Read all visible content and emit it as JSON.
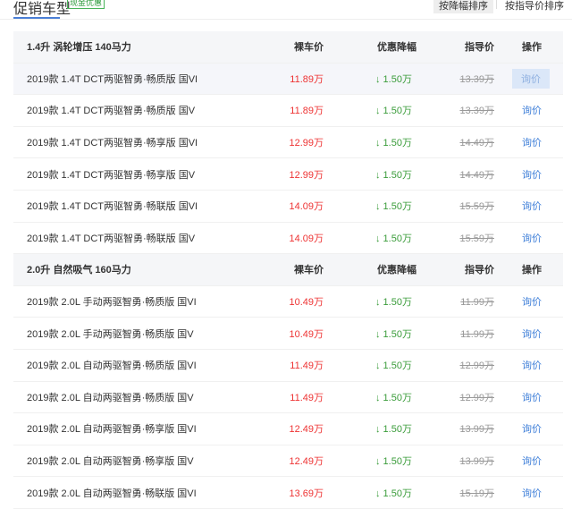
{
  "header": {
    "title": "促销车型",
    "badge": "现金优惠",
    "sort_by_discount": "按降幅排序",
    "sort_by_guide": "按指导价排序"
  },
  "columns": {
    "price": "裸车价",
    "discount": "优惠降幅",
    "guide": "指导价",
    "action": "操作"
  },
  "groups": [
    {
      "name": "1.4升 涡轮增压 140马力",
      "rows": [
        {
          "name": "2019款 1.4T DCT两驱智勇·畅质版 国VI",
          "price": "11.89万",
          "discount": "↓ 1.50万",
          "guide": "13.39万",
          "action": "询价"
        },
        {
          "name": "2019款 1.4T DCT两驱智勇·畅质版 国V",
          "price": "11.89万",
          "discount": "↓ 1.50万",
          "guide": "13.39万",
          "action": "询价"
        },
        {
          "name": "2019款 1.4T DCT两驱智勇·畅享版 国VI",
          "price": "12.99万",
          "discount": "↓ 1.50万",
          "guide": "14.49万",
          "action": "询价"
        },
        {
          "name": "2019款 1.4T DCT两驱智勇·畅享版 国V",
          "price": "12.99万",
          "discount": "↓ 1.50万",
          "guide": "14.49万",
          "action": "询价"
        },
        {
          "name": "2019款 1.4T DCT两驱智勇·畅联版 国VI",
          "price": "14.09万",
          "discount": "↓ 1.50万",
          "guide": "15.59万",
          "action": "询价"
        },
        {
          "name": "2019款 1.4T DCT两驱智勇·畅联版 国V",
          "price": "14.09万",
          "discount": "↓ 1.50万",
          "guide": "15.59万",
          "action": "询价"
        }
      ]
    },
    {
      "name": "2.0升 自然吸气 160马力",
      "rows": [
        {
          "name": "2019款 2.0L 手动两驱智勇·畅质版 国VI",
          "price": "10.49万",
          "discount": "↓ 1.50万",
          "guide": "11.99万",
          "action": "询价"
        },
        {
          "name": "2019款 2.0L 手动两驱智勇·畅质版 国V",
          "price": "10.49万",
          "discount": "↓ 1.50万",
          "guide": "11.99万",
          "action": "询价"
        },
        {
          "name": "2019款 2.0L 自动两驱智勇·畅质版 国VI",
          "price": "11.49万",
          "discount": "↓ 1.50万",
          "guide": "12.99万",
          "action": "询价"
        },
        {
          "name": "2019款 2.0L 自动两驱智勇·畅质版 国V",
          "price": "11.49万",
          "discount": "↓ 1.50万",
          "guide": "12.99万",
          "action": "询价"
        },
        {
          "name": "2019款 2.0L 自动两驱智勇·畅享版 国VI",
          "price": "12.49万",
          "discount": "↓ 1.50万",
          "guide": "13.99万",
          "action": "询价"
        },
        {
          "name": "2019款 2.0L 自动两驱智勇·畅享版 国V",
          "price": "12.49万",
          "discount": "↓ 1.50万",
          "guide": "13.99万",
          "action": "询价"
        },
        {
          "name": "2019款 2.0L 自动两驱智勇·畅联版 国VI",
          "price": "13.69万",
          "discount": "↓ 1.50万",
          "guide": "15.19万",
          "action": "询价"
        }
      ]
    }
  ]
}
